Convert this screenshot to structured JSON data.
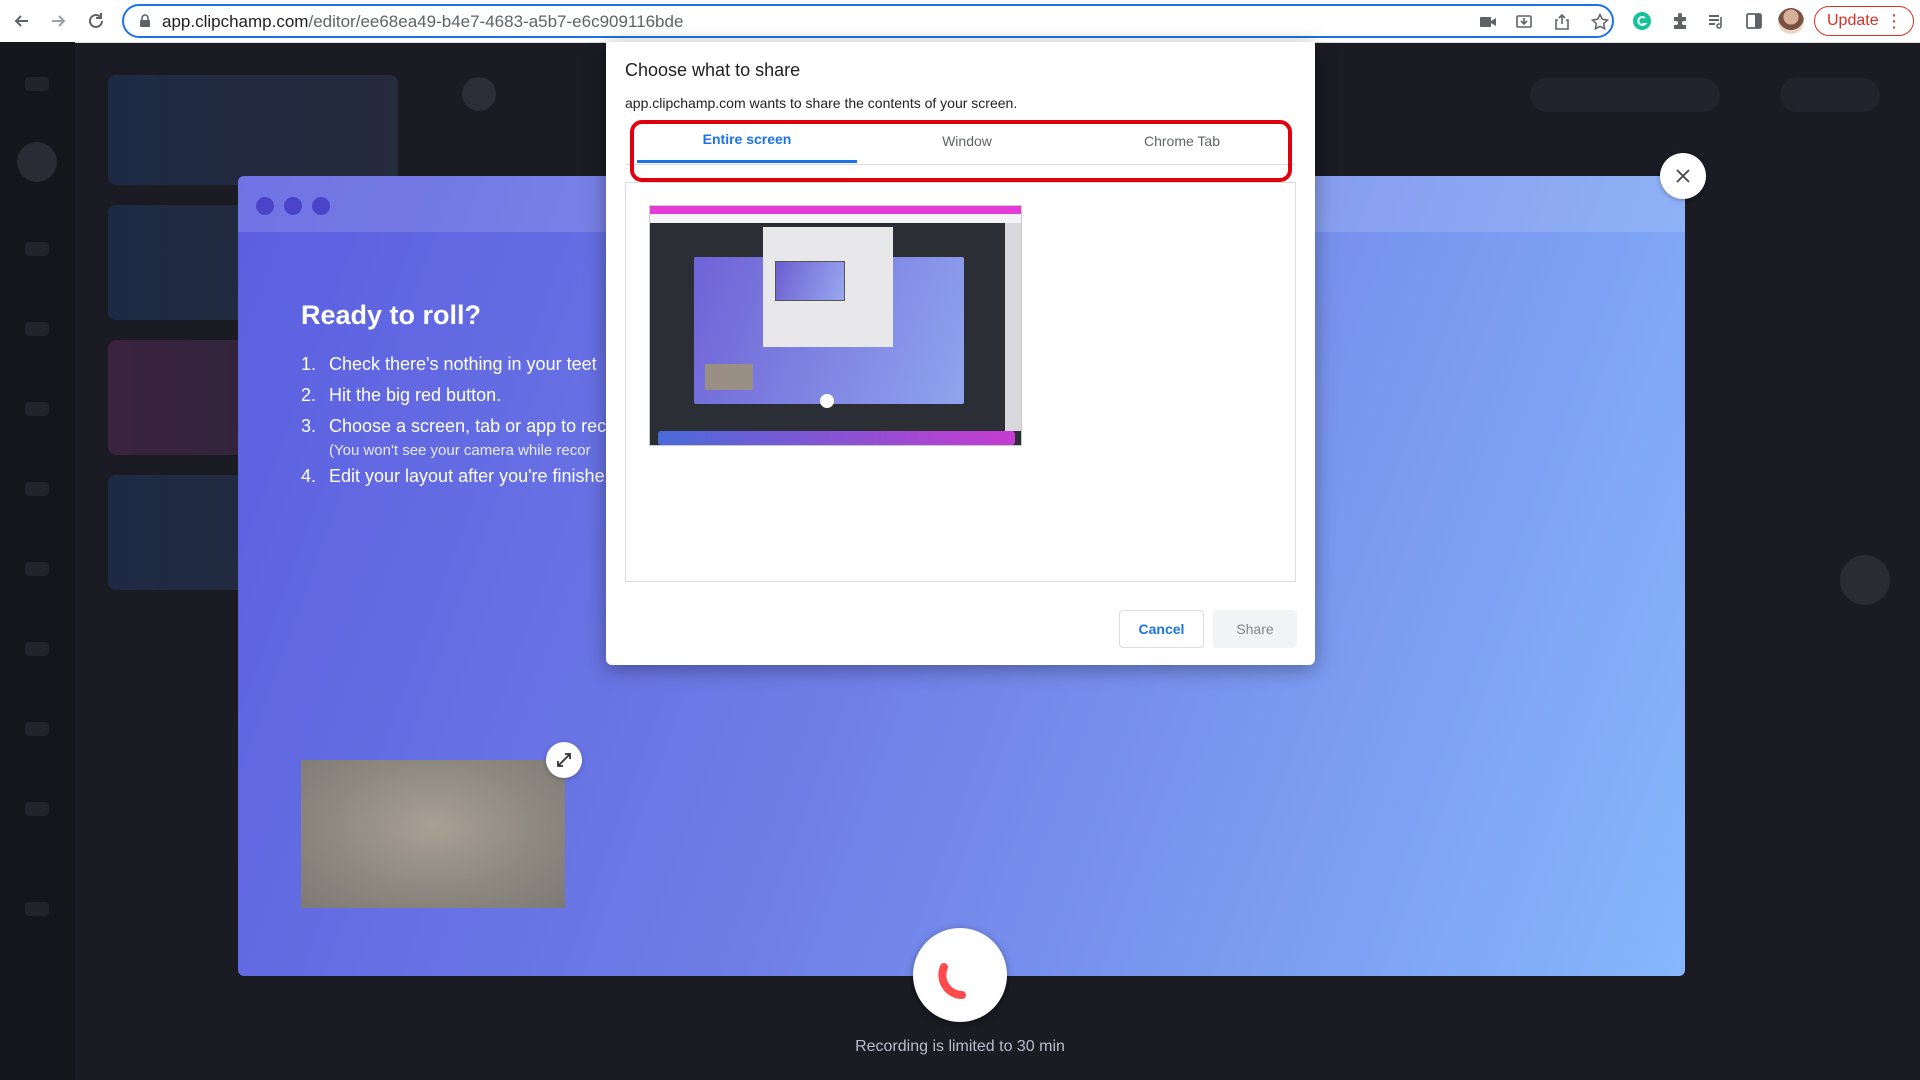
{
  "browser": {
    "url_host": "app.clipchamp.com",
    "url_path": "/editor/ee68ea49-b4e7-4683-a5b7-e6c909116bde",
    "update_label": "Update",
    "accent": "#1a73e8",
    "update_color": "#d93025"
  },
  "recorder": {
    "title": "Ready to roll?",
    "steps": [
      {
        "num": "1.",
        "text": "Check there's nothing in your teet"
      },
      {
        "num": "2.",
        "text": "Hit the big red button."
      },
      {
        "num": "3.",
        "text": "Choose a screen, tab or app to rec"
      },
      {
        "num": "4.",
        "text": "Edit your layout after you're finishe"
      }
    ],
    "step3_note": "(You won't see your camera while recor",
    "limit_text": "Recording is limited to 30 min",
    "record_color": "#ff4b4b"
  },
  "dialog": {
    "title": "Choose what to share",
    "subtitle": "app.clipchamp.com wants to share the contents of your screen.",
    "tabs": [
      "Entire screen",
      "Window",
      "Chrome Tab"
    ],
    "active_tab": "Entire screen",
    "cancel_label": "Cancel",
    "share_label": "Share",
    "highlight_color": "#e1000f"
  }
}
